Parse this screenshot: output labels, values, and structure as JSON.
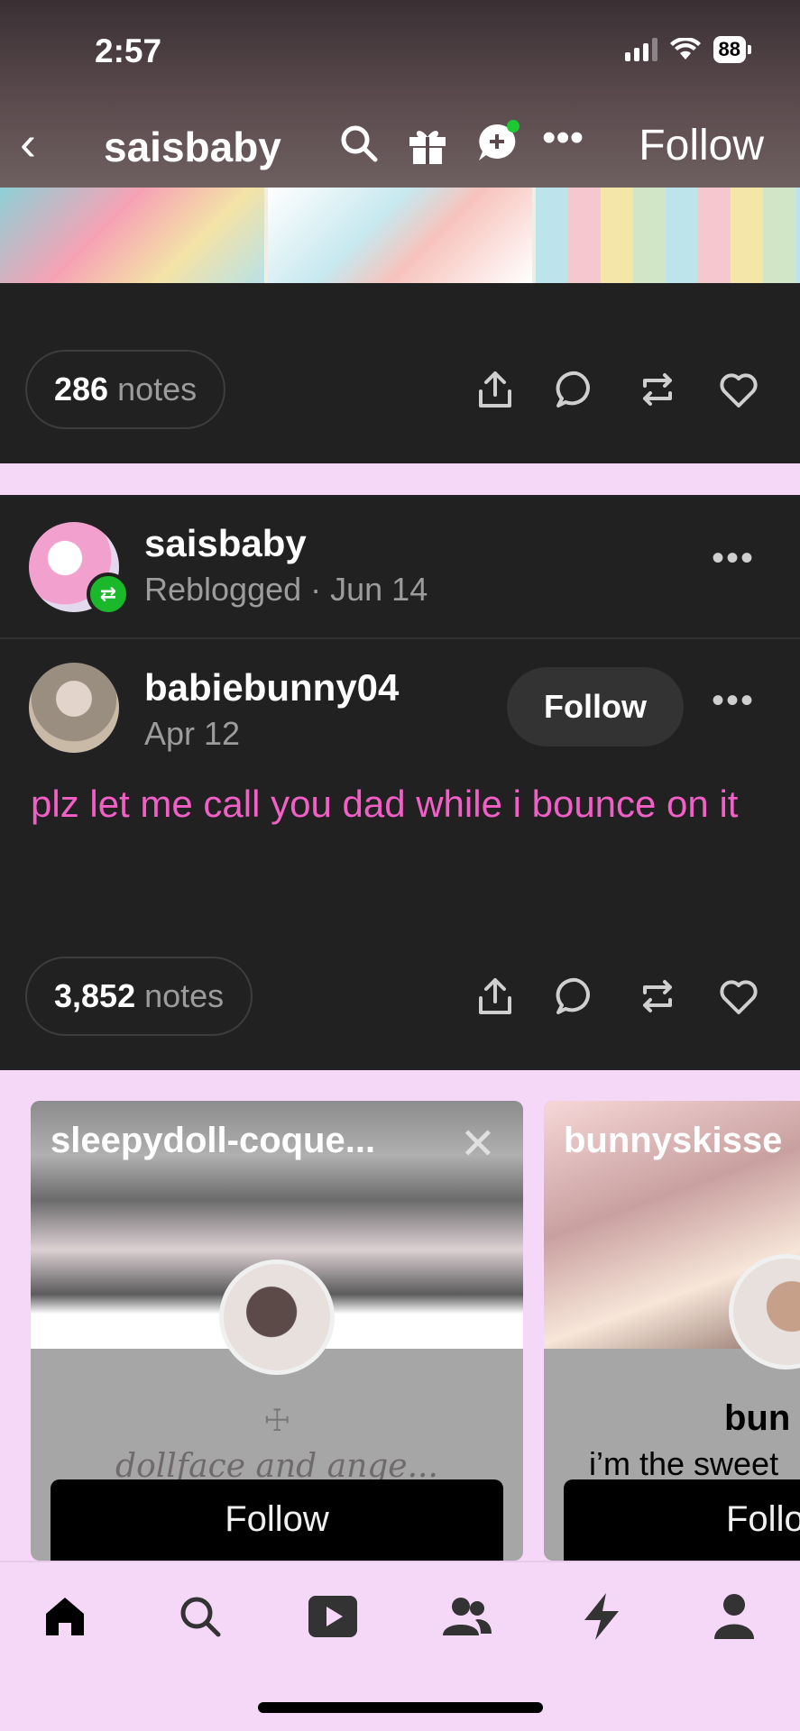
{
  "status": {
    "time": "2:57",
    "battery": "88"
  },
  "header": {
    "blog_name": "saisbaby",
    "follow_label": "Follow"
  },
  "post1": {
    "notes_count": "286",
    "notes_label": "notes"
  },
  "post2": {
    "reblogger": "saisbaby",
    "reblog_info": "Reblogged · Jun 14",
    "author": "babiebunny04",
    "date": "Apr 12",
    "follow_label": "Follow",
    "text": "plz let me call you dad while i bounce on it",
    "notes_count": "3,852",
    "notes_label": "notes"
  },
  "recommendations": [
    {
      "name": "sleepydoll-coque...",
      "description": "dollface and ange...",
      "follow_label": "Follow"
    },
    {
      "name": "bunnyskisse",
      "title": "bun",
      "description": "i’m the sweet",
      "follow_label": "Follo"
    }
  ],
  "tabs": [
    "home-icon",
    "search-icon",
    "video-icon",
    "people-icon",
    "activity-icon",
    "profile-icon"
  ],
  "colors": {
    "accent_pink": "#f25fc6",
    "card_bg": "#212121",
    "page_bg": "#f5d8f7",
    "reblog_green": "#1cb82c"
  }
}
